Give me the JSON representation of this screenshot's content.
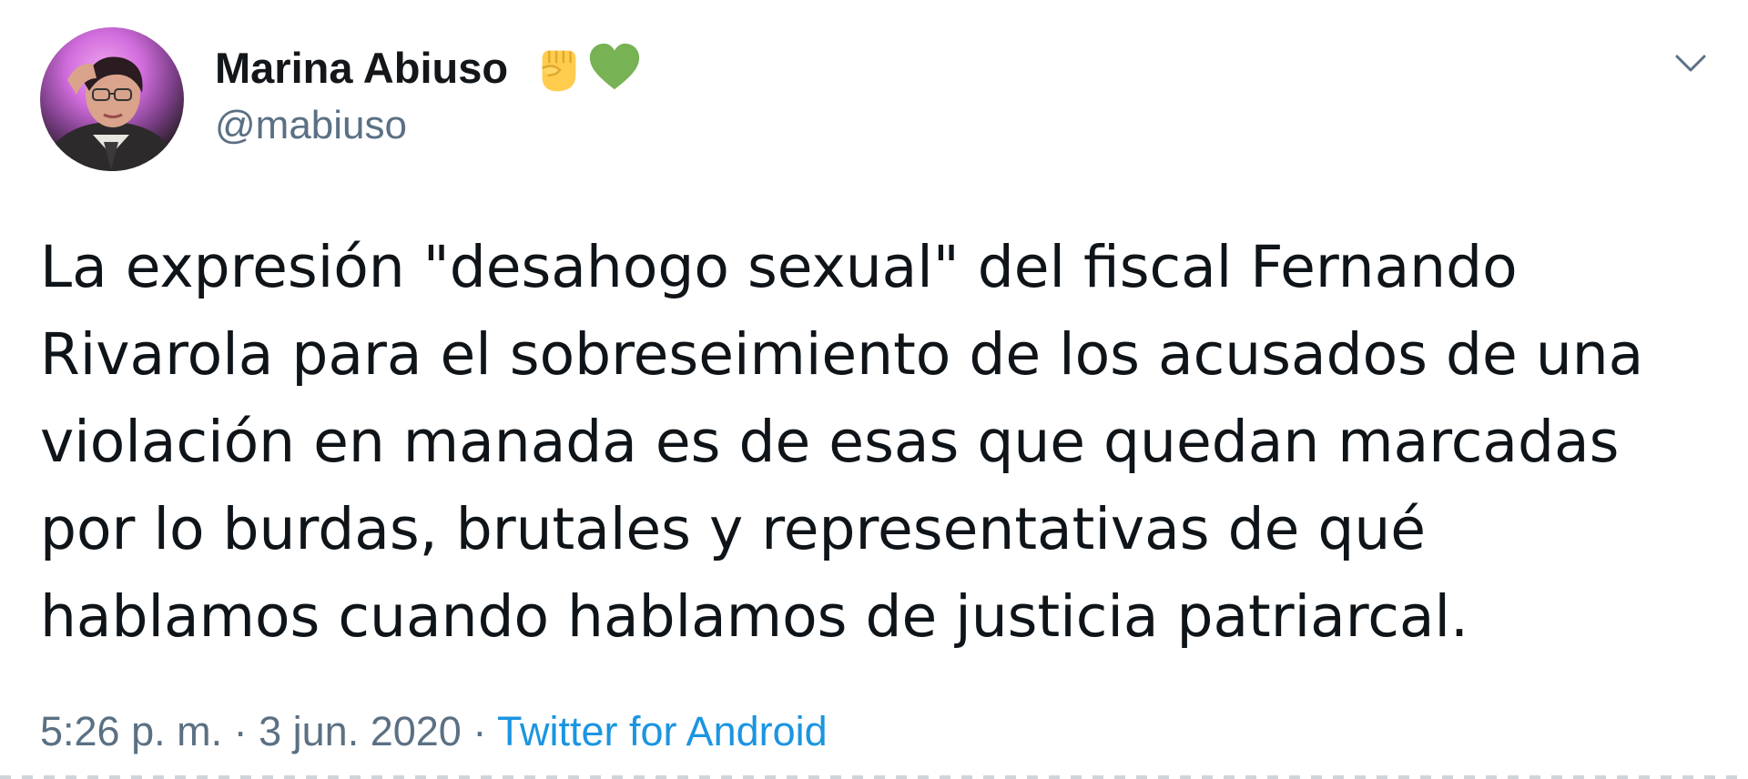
{
  "user": {
    "display_name": "Marina Abiuso",
    "handle": "@mabiuso",
    "badges": [
      "raised-fist-emoji",
      "green-heart-emoji"
    ]
  },
  "tweet": {
    "lines": [
      "La expresión \"desahogo sexual\" del fiscal Fernando",
      "Rivarola para el sobreseimiento de los acusados de una",
      "violación en manada es de esas que quedan marcadas",
      "por lo burdas, brutales y representativas de qué",
      "hablamos cuando hablamos de justicia patriarcal."
    ]
  },
  "meta": {
    "time": "5:26 p. m.",
    "separator1": " · ",
    "date": "3 jun. 2020",
    "separator2": " · ",
    "source": "Twitter for Android"
  },
  "icons": {
    "caret": "chevron-down-icon"
  },
  "colors": {
    "name": "#14171a",
    "secondary": "#5b7083",
    "link": "#1b95e0",
    "body_text": "#0f1419"
  }
}
